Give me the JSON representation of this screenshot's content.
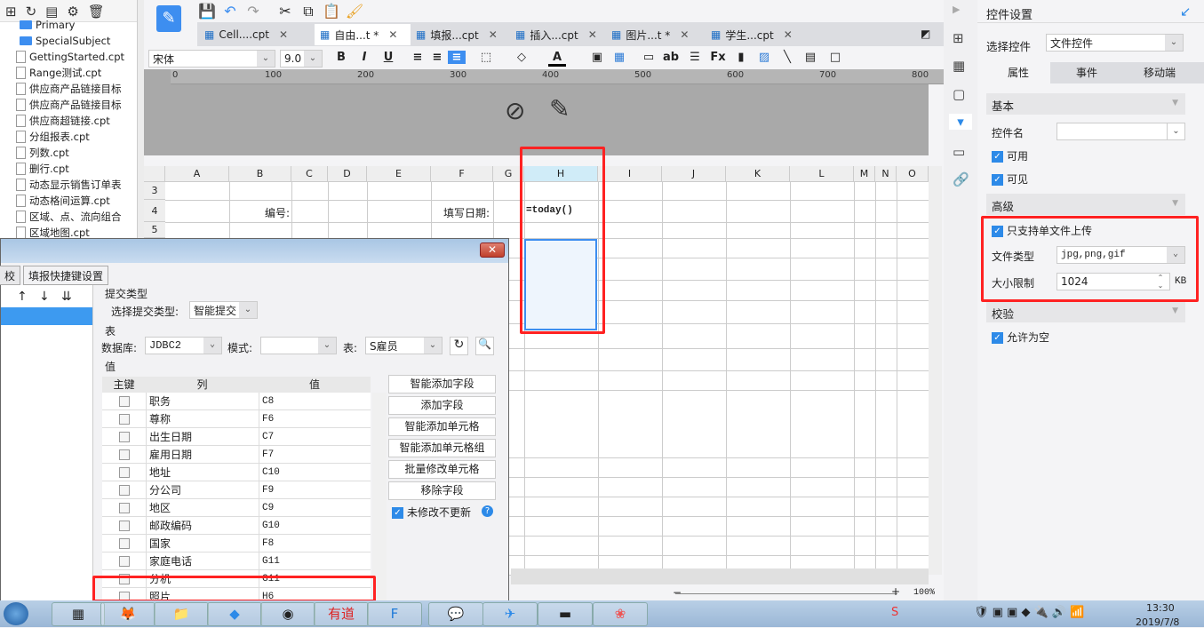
{
  "file_panel": {
    "toolbar_icons": [
      "new-folder-icon",
      "refresh-icon",
      "template-icon",
      "settings-icon",
      "delete-icon"
    ],
    "folders": [
      "Primary",
      "SpecialSubject"
    ],
    "files": [
      "GettingStarted.cpt",
      "Range测试.cpt",
      "供应商产品链接目标",
      "供应商产品链接目标",
      "供应商超链接.cpt",
      "分组报表.cpt",
      "列数.cpt",
      "删行.cpt",
      "动态显示销售订单表",
      "动态格间运算.cpt",
      "区域、点、流向组合",
      "区域地图.cpt"
    ]
  },
  "tabs": [
    {
      "label": "Cell....cpt"
    },
    {
      "label": "自由...t *",
      "active": true
    },
    {
      "label": "填报...cpt"
    },
    {
      "label": "插入...cpt"
    },
    {
      "label": "图片...t *"
    },
    {
      "label": "学生...cpt"
    }
  ],
  "format": {
    "font": "宋体",
    "size": "9.0",
    "bold": "B",
    "italic": "I",
    "underline": "U"
  },
  "ruler": [
    "0",
    "100",
    "200",
    "300",
    "400",
    "500",
    "600",
    "700",
    "800"
  ],
  "sheet": {
    "columns": [
      "A",
      "B",
      "C",
      "D",
      "E",
      "F",
      "G",
      "H",
      "I",
      "J",
      "K",
      "L",
      "M",
      "N",
      "O"
    ],
    "rows": [
      "3",
      "4",
      "5"
    ],
    "cells": {
      "b4": "编号:",
      "f4": "填写日期:",
      "h4": "=today()"
    },
    "zoom": "100%"
  },
  "dialog": {
    "tabs": [
      "校验",
      "填报快捷键设置"
    ],
    "submit_group": "提交类型",
    "submit_label": "选择提交类型:",
    "submit_value": "智能提交",
    "table_group": "表",
    "db_label": "数据库:",
    "db_value": "JDBC2",
    "schema_label": "模式:",
    "schema_value": "",
    "table_label": "表:",
    "table_value": "S雇员",
    "value_group": "值",
    "headers": [
      "主键",
      "列",
      "值"
    ],
    "rows": [
      [
        "职务",
        "C8"
      ],
      [
        "尊称",
        "F6"
      ],
      [
        "出生日期",
        "C7"
      ],
      [
        "雇用日期",
        "F7"
      ],
      [
        "地址",
        "C10"
      ],
      [
        "分公司",
        "F9"
      ],
      [
        "地区",
        "C9"
      ],
      [
        "邮政编码",
        "G10"
      ],
      [
        "国家",
        "F8"
      ],
      [
        "家庭电话",
        "G11"
      ],
      [
        "分机",
        "G11"
      ],
      [
        "照片",
        "H6"
      ]
    ],
    "buttons": [
      "智能添加字段",
      "添加字段",
      "智能添加单元格",
      "智能添加单元格组",
      "批量修改单元格",
      "移除字段"
    ],
    "no_update": "未修改不更新"
  },
  "right_panel": {
    "title": "控件设置",
    "select_label": "选择控件",
    "select_value": "文件控件",
    "tabs": [
      "属性",
      "事件",
      "移动端"
    ],
    "basic": "基本",
    "name_label": "控件名",
    "name_value": "",
    "enabled": "可用",
    "visible": "可见",
    "advanced": "高级",
    "single_upload": "只支持单文件上传",
    "file_type_label": "文件类型",
    "file_type_value": "jpg,png,gif",
    "size_label": "大小限制",
    "size_value": "1024",
    "size_unit": "KB",
    "validate": "校验",
    "allow_empty": "允许为空"
  },
  "taskbar": {
    "time": "13:30",
    "date": "2019/7/8"
  }
}
